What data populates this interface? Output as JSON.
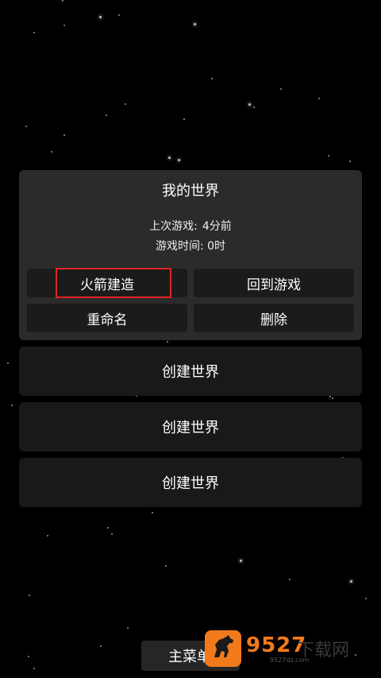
{
  "panel": {
    "title": "我的世界",
    "last_played_label": "上次游戏:",
    "last_played_value": "4分前",
    "play_time_label": "游戏时间:",
    "play_time_value": "0时"
  },
  "buttons": {
    "rocket_build": "火箭建造",
    "return_to_game": "回到游戏",
    "rename": "重命名",
    "delete": "删除"
  },
  "slots": [
    {
      "label": "创建世界"
    },
    {
      "label": "创建世界"
    },
    {
      "label": "创建世界"
    }
  ],
  "main_menu": {
    "label": "主菜单"
  },
  "watermark": {
    "number": "9527",
    "text": "下载网",
    "url": "9527dz.com"
  },
  "colors": {
    "background": "#000000",
    "panel": "#2b2b2b",
    "button": "#1b1b1b",
    "slot": "#191919",
    "highlight": "#e02424",
    "watermark_orange": "#f37a1a"
  },
  "icons": {
    "watermark_logo": "horse-icon"
  }
}
